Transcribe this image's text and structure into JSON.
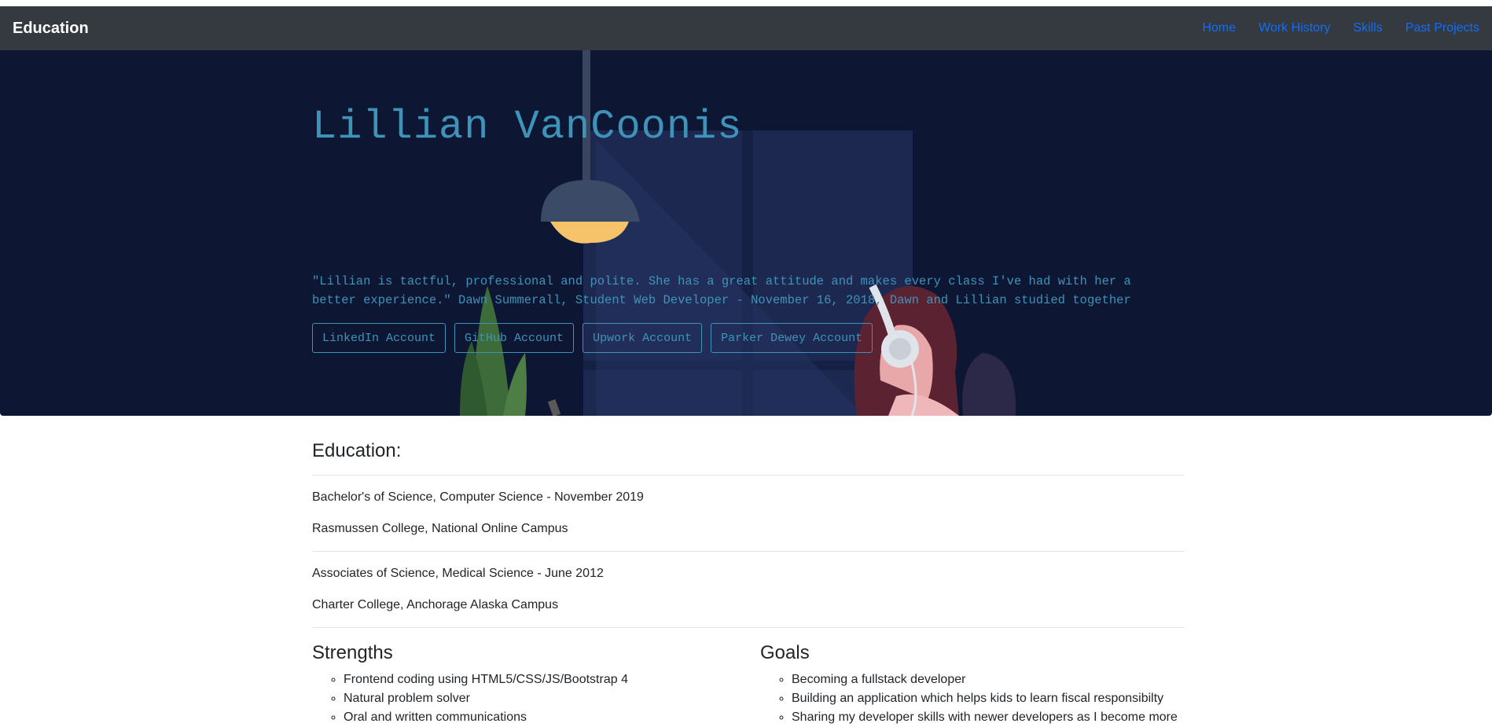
{
  "navbar": {
    "brand": "Education",
    "links": [
      "Home",
      "Work History",
      "Skills",
      "Past Projects"
    ]
  },
  "hero": {
    "title": "Lillian VanCoonis",
    "quote": "\"Lillian is tactful, professional and polite. She has a great attitude and makes every class I've had with her a better experience.\" Dawn Summerall, Student Web Developer - November 16, 2018, Dawn and Lillian studied together",
    "buttons": [
      "LinkedIn Account",
      "GitHub Account",
      "Upwork Account",
      "Parker Dewey Account"
    ]
  },
  "education": {
    "heading": "Education:",
    "entries": [
      {
        "degree": "Bachelor's of Science, Computer Science - November 2019",
        "school": "Rasmussen College, National Online Campus"
      },
      {
        "degree": "Associates of Science, Medical Science - June 2012",
        "school": "Charter College, Anchorage Alaska Campus"
      }
    ]
  },
  "strengths": {
    "heading": "Strengths",
    "items": [
      "Frontend coding using HTML5/CSS/JS/Bootstrap 4",
      "Natural problem solver",
      "Oral and written communications"
    ]
  },
  "goals": {
    "heading": "Goals",
    "items": [
      "Becoming a fullstack developer",
      "Building an application which helps kids to learn fiscal responsibilty",
      "Sharing my developer skills with newer developers as I become more"
    ]
  },
  "colors": {
    "navbar_bg": "#343a40",
    "hero_bg": "#0d1633",
    "accent_text": "#3f93b8",
    "link": "#0d6efd"
  }
}
